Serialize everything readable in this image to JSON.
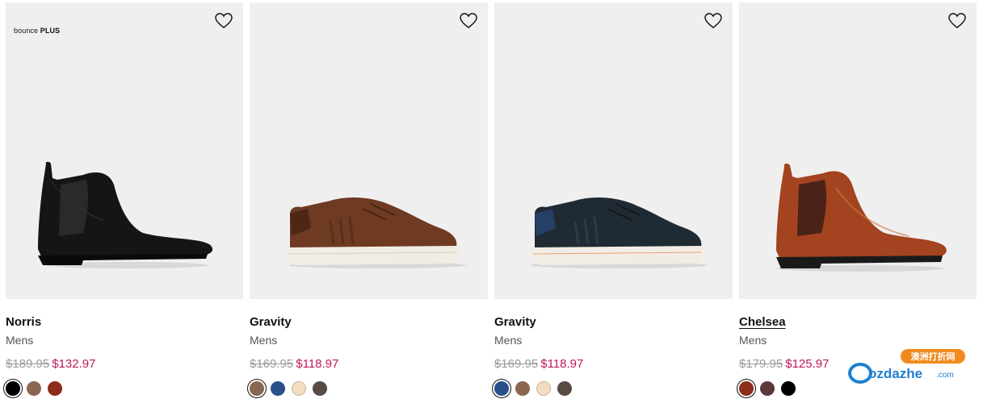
{
  "products": [
    {
      "badge": "bounce",
      "badge_strong": "PLUS",
      "name": "Norris",
      "category": "Mens",
      "original_price": "$189.95",
      "sale_price": "$132.97",
      "swatches": [
        "#000000",
        "#8b6650",
        "#8b2d1a"
      ],
      "selected_swatch": 0
    },
    {
      "name": "Gravity",
      "category": "Mens",
      "original_price": "$169.95",
      "sale_price": "$118.97",
      "swatches": [
        "#8b6650",
        "#2b4f8c",
        "#f3dcc0",
        "#5a4a44"
      ],
      "selected_swatch": 0
    },
    {
      "name": "Gravity",
      "category": "Mens",
      "original_price": "$169.95",
      "sale_price": "$118.97",
      "swatches": [
        "#2b4f8c",
        "#8b6650",
        "#f3dcc0",
        "#5a4a44"
      ],
      "selected_swatch": 0
    },
    {
      "name": "Chelsea",
      "category": "Mens",
      "original_price": "$179.95",
      "sale_price": "$125.97",
      "swatches": [
        "#8b2d1a",
        "#5a3a38",
        "#000000"
      ],
      "selected_swatch": 0
    }
  ],
  "watermark": {
    "text": "ozdazhe",
    "suffix": ".com",
    "tag": "澳洲打折网"
  },
  "colors": {
    "sale": "#c0185a",
    "strike": "#9a9a9a",
    "tile_bg": "#efefef"
  }
}
